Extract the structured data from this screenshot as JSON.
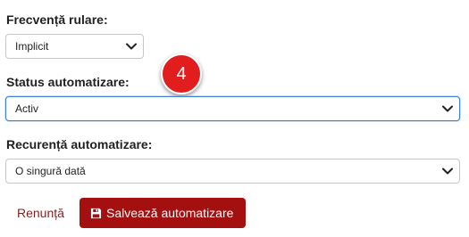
{
  "form": {
    "run_frequency": {
      "label": "Frecvență rulare:",
      "value": "Implicit"
    },
    "automation_status": {
      "label": "Status automatizare:",
      "value": "Activ"
    },
    "automation_recurrence": {
      "label": "Recurență automatizare:",
      "value": "O singură dată"
    }
  },
  "step_badge": "4",
  "actions": {
    "cancel_label": "Renunță",
    "save_label": "Salvează automatizare"
  },
  "icons": {
    "select_chevron": "chevron-down-icon",
    "save": "floppy-disk-icon"
  },
  "colors": {
    "primary_button": "#a40f0f",
    "link": "#8b1d1d",
    "badge": "#e21d1d",
    "focus_border": "#3b82d6"
  }
}
